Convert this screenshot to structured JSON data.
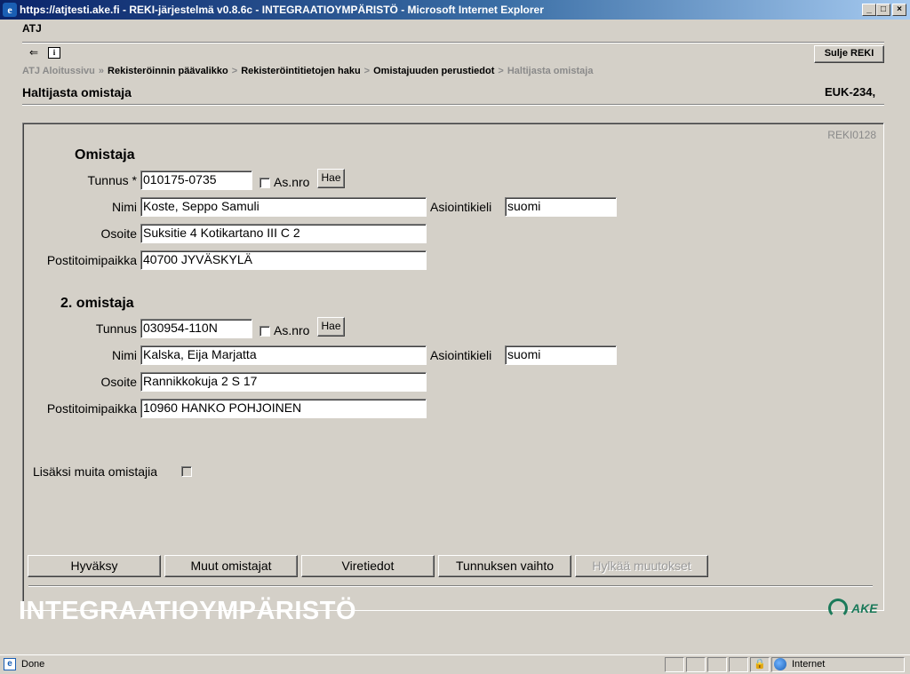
{
  "window": {
    "title": "https://atjtesti.ake.fi - REKI-järjestelmä v0.8.6c - INTEGRAATIOYMPÄRISTÖ - Microsoft Internet Explorer",
    "minimize": "_",
    "maximize": "□",
    "close": "×"
  },
  "app": {
    "name": "ATJ",
    "close_button": "Sulje REKI",
    "back_glyph": "⇐",
    "info_glyph": "i"
  },
  "breadcrumb": {
    "items": [
      "ATJ Aloitussivu",
      "Rekisteröinnin päävalikko",
      "Rekisteröintitietojen haku",
      "Omistajuuden perustiedot",
      "Haltijasta omistaja"
    ],
    "separators": [
      "»",
      ">",
      ">",
      ">"
    ]
  },
  "page": {
    "title": "Haltijasta omistaja",
    "registration": "EUK-234,",
    "form_code": "REKI0128"
  },
  "owner1": {
    "heading": "Omistaja",
    "id_label": "Tunnus *",
    "id_value": "010175-0735",
    "asnro_label": "As.nro",
    "search_button": "Hae",
    "name_label": "Nimi",
    "name_value": "Koste, Seppo Samuli",
    "language_label": "Asiointikieli",
    "language_value": "suomi",
    "address_label": "Osoite",
    "address_value": "Suksitie 4 Kotikartano III  C 2",
    "postal_label": "Postitoimipaikka",
    "postal_value": "40700  JYVÄSKYLÄ"
  },
  "owner2": {
    "heading": "2. omistaja",
    "id_label": "Tunnus",
    "id_value": "030954-110N",
    "asnro_label": "As.nro",
    "search_button": "Hae",
    "name_label": "Nimi",
    "name_value": "Kalska, Eija Marjatta",
    "language_label": "Asiointikieli",
    "language_value": "suomi",
    "address_label": "Osoite",
    "address_value": "Rannikkokuja 2 S 17",
    "postal_label": "Postitoimipaikka",
    "postal_value": "10960  HANKO POHJOINEN"
  },
  "extra_owners_label": "Lisäksi muita omistajia",
  "buttons": {
    "accept": "Hyväksy",
    "other_owners": "Muut omistajat",
    "vehicle_data": "Viretiedot",
    "change_id": "Tunnuksen vaihto",
    "discard": "Hylkää muutokset"
  },
  "environment": "INTEGRAATIOYMPÄRISTÖ",
  "logo_text": "AKE",
  "status": {
    "text": "Done",
    "zone": "Internet",
    "done_glyph": "e",
    "lock_glyph": "🔒"
  },
  "colors": {
    "title_bar": "#0a246a",
    "logo_green": "#1b7a5a",
    "window_bg": "#d4d0c8"
  }
}
